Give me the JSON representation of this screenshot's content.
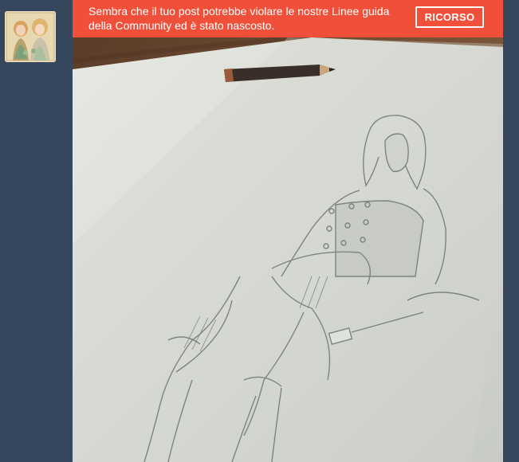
{
  "avatar": {
    "icon": "blog-avatar-portrait-icon"
  },
  "banner": {
    "message": "Sembra che il tuo post potrebbe violare le nostre Linee guida della Community ed è stato nascosto.",
    "appeal_label": "RICORSO",
    "color": "#f0503a"
  },
  "post": {
    "image": {
      "icon": "pencil-sketch-photo-icon"
    }
  },
  "colors": {
    "background": "#36465d",
    "banner": "#f0503a",
    "paper": "#d9dcd6",
    "table": "#6b4a33"
  }
}
